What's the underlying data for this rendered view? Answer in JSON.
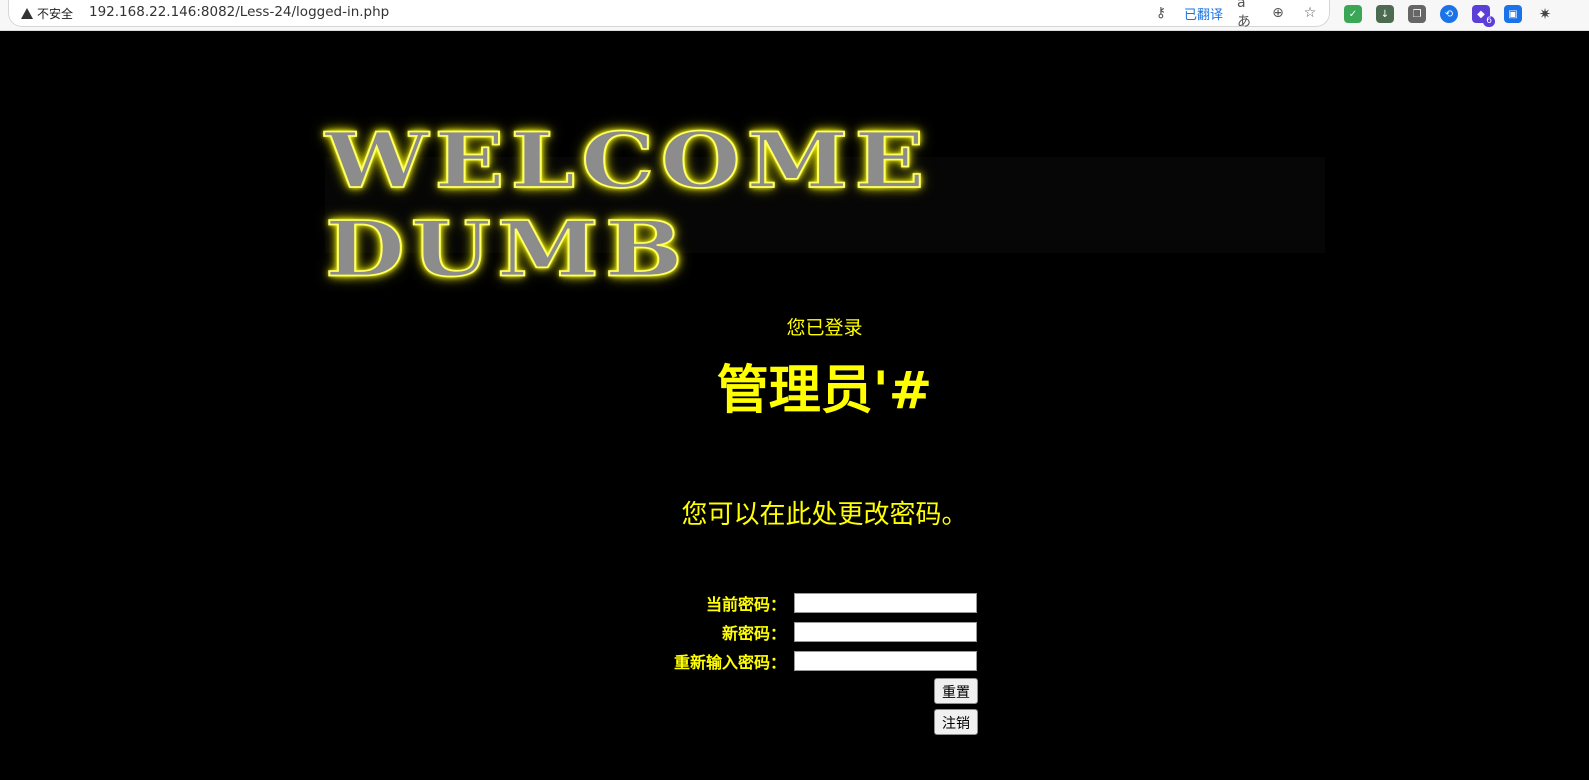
{
  "browser": {
    "security_label": "不安全",
    "url": "192.168.22.146:8082/Less-24/logged-in.php",
    "translated_label": "已翻译",
    "translate_glyph": "aあ",
    "extension_badge": "6"
  },
  "page": {
    "banner_text": "WELCOME DUMB",
    "logged_in_text": "您已登录",
    "username": "管理员'#",
    "change_password_text": "您可以在此处更改密码。",
    "form": {
      "current_password_label": "当前密码：",
      "new_password_label": "新密码：",
      "retype_password_label": "重新输入密码：",
      "reset_button": "重置",
      "logout_button": "注销"
    }
  },
  "colors": {
    "background": "#000000",
    "text": "#ffff00"
  }
}
